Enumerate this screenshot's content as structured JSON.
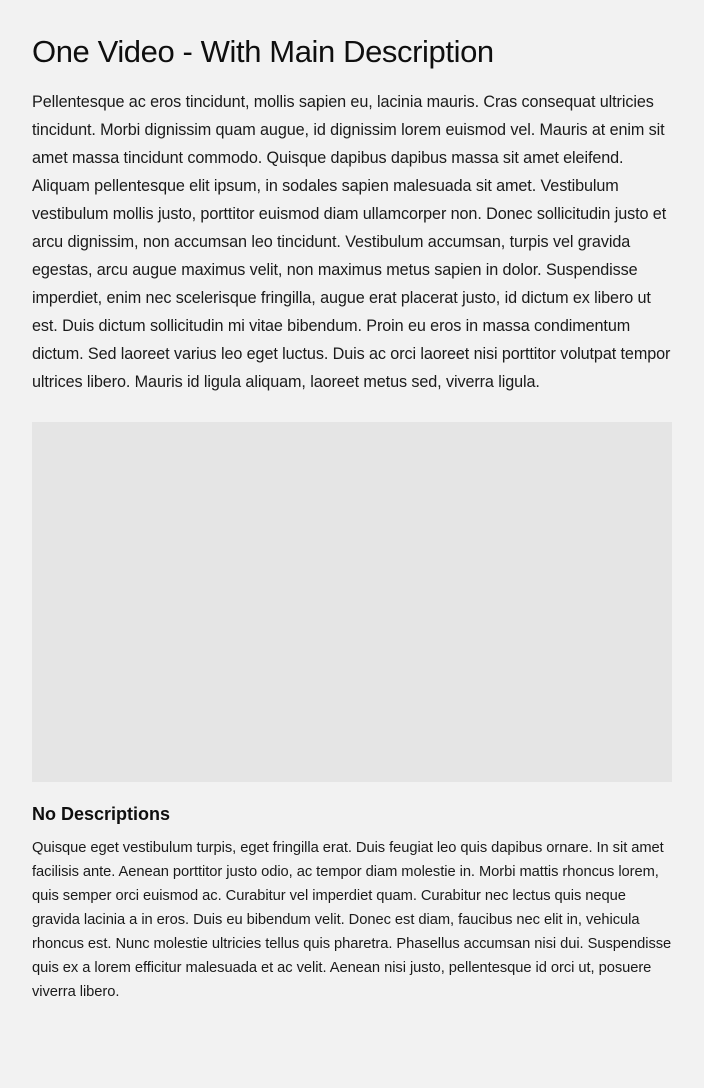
{
  "page": {
    "title": "One Video - With Main Description",
    "description": "Pellentesque ac eros tincidunt, mollis sapien eu, lacinia mauris. Cras consequat ultricies tincidunt. Morbi dignissim quam augue, id dignissim lorem euismod vel. Mauris at enim sit amet massa tincidunt commodo. Quisque dapibus dapibus massa sit amet eleifend. Aliquam pellentesque elit ipsum, in sodales sapien malesuada sit amet. Vestibulum vestibulum mollis justo, porttitor euismod diam ullamcorper non. Donec sollicitudin justo et arcu dignissim, non accumsan leo tincidunt. Vestibulum accumsan, turpis vel gravida egestas, arcu augue maximus velit, non maximus metus sapien in dolor. Suspendisse imperdiet, enim nec scelerisque fringilla, augue erat placerat justo, id dictum ex libero ut est. Duis dictum sollicitudin mi vitae bibendum. Proin eu eros in massa condimentum dictum. Sed laoreet varius leo eget luctus. Duis ac orci laoreet nisi porttitor volutpat tempor ultrices libero. Mauris id ligula aliquam, laoreet metus sed, viverra ligula."
  },
  "video": {
    "title": "No Descriptions",
    "description": "Quisque eget vestibulum turpis, eget fringilla erat. Duis feugiat leo quis dapibus ornare. In sit amet facilisis ante. Aenean porttitor justo odio, ac tempor diam molestie in. Morbi mattis rhoncus lorem, quis semper orci euismod ac. Curabitur vel imperdiet quam. Curabitur nec lectus quis neque gravida lacinia a in eros. Duis eu bibendum velit. Donec est diam, faucibus nec elit in, vehicula rhoncus est. Nunc molestie ultricies tellus quis pharetra. Phasellus accumsan nisi dui. Suspendisse quis ex a lorem efficitur malesuada et ac velit. Aenean nisi justo, pellentesque id orci ut, posuere viverra libero."
  },
  "colors": {
    "page_background": "#f2f2f2",
    "video_placeholder": "#e5e5e5",
    "text": "#111111"
  }
}
